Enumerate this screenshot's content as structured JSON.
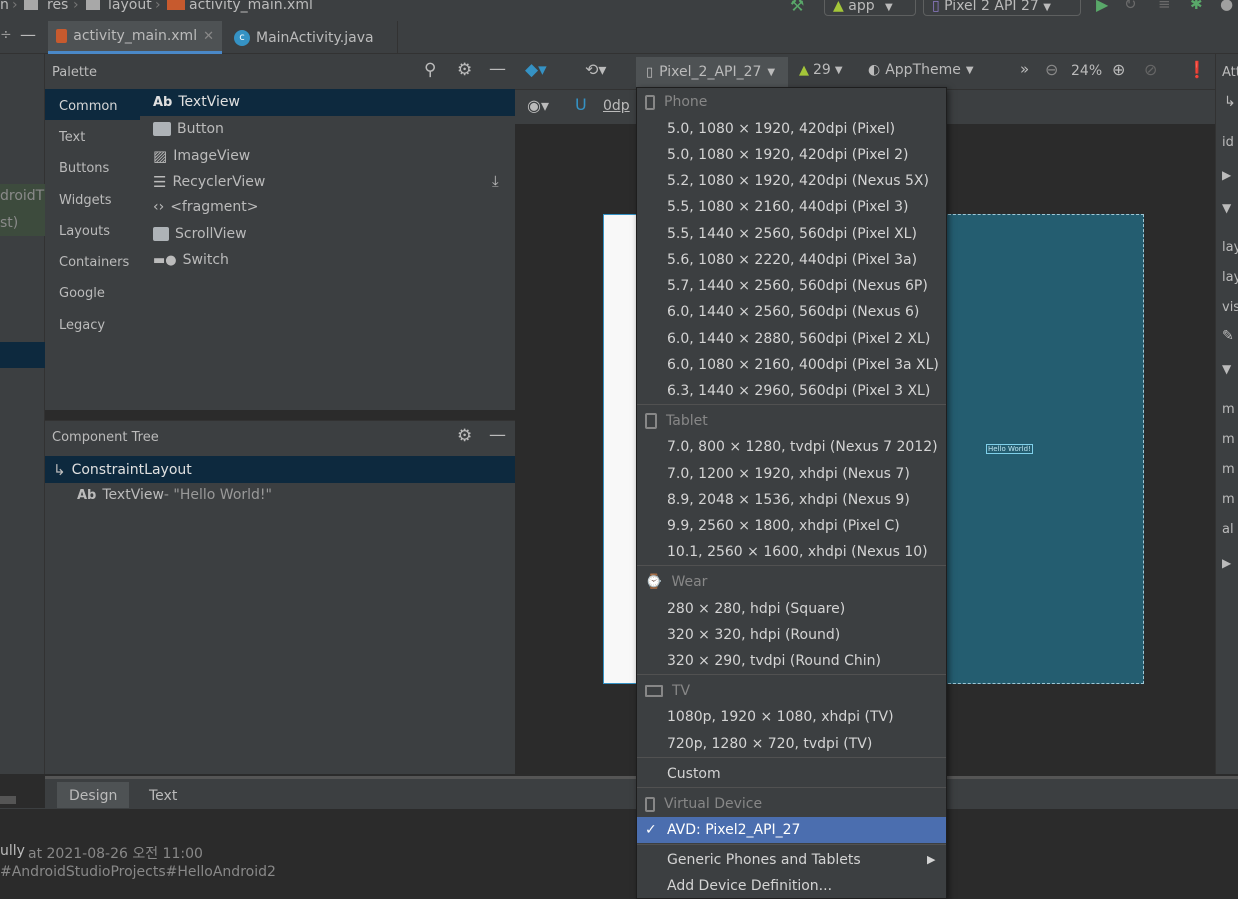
{
  "breadcrumb": {
    "first": "n",
    "res": "res",
    "layout": "layout",
    "file": "activity_main.xml"
  },
  "run_toolbar": {
    "module": "app",
    "device": "Pixel 2 API 27"
  },
  "editor_tabs": [
    {
      "label": "activity_main.xml",
      "active": true
    },
    {
      "label": "MainActivity.java",
      "active": false
    }
  ],
  "palette": {
    "title": "Palette",
    "categories": [
      "Common",
      "Text",
      "Buttons",
      "Widgets",
      "Layouts",
      "Containers",
      "Google",
      "Legacy"
    ],
    "items": [
      "TextView",
      "Button",
      "ImageView",
      "RecyclerView",
      "<fragment>",
      "ScrollView",
      "Switch"
    ],
    "textview_prefix": "Ab"
  },
  "component_tree": {
    "title": "Component Tree",
    "root": "ConstraintLayout",
    "child_prefix": "Ab",
    "child": "TextView",
    "child_text": "- \"Hello World!\""
  },
  "left_strip": {
    "line1": "droidT",
    "line2": "st)"
  },
  "design_toolbar": {
    "device": "Pixel_2_API_27",
    "api": "29",
    "theme": "AppTheme",
    "zoom": "24%",
    "margin": "0dp"
  },
  "canvas": {
    "hello_label": "Hello World!"
  },
  "right_panel": {
    "title": "Att",
    "labels": [
      "id",
      "lay",
      "lay",
      "vis",
      "m",
      "m",
      "m",
      "m",
      "al"
    ]
  },
  "bottom_tabs": [
    "Design",
    "Text"
  ],
  "status": {
    "user": "ully",
    "at": "at 2021-08-26 오전 11:00",
    "path": "#AndroidStudioProjects#HelloAndroid2"
  },
  "dropdown": {
    "phone_header": "Phone",
    "phones": [
      "5.0, 1080 × 1920, 420dpi (Pixel)",
      "5.0, 1080 × 1920, 420dpi (Pixel 2)",
      "5.2, 1080 × 1920, 420dpi (Nexus 5X)",
      "5.5, 1080 × 2160, 440dpi (Pixel 3)",
      "5.5, 1440 × 2560, 560dpi (Pixel XL)",
      "5.6, 1080 × 2220, 440dpi (Pixel 3a)",
      "5.7, 1440 × 2560, 560dpi (Nexus 6P)",
      "6.0, 1440 × 2560, 560dpi (Nexus 6)",
      "6.0, 1440 × 2880, 560dpi (Pixel 2 XL)",
      "6.0, 1080 × 2160, 400dpi (Pixel 3a XL)",
      "6.3, 1440 × 2960, 560dpi (Pixel 3 XL)"
    ],
    "tablet_header": "Tablet",
    "tablets": [
      "7.0, 800 × 1280, tvdpi (Nexus 7 2012)",
      "7.0, 1200 × 1920, xhdpi (Nexus 7)",
      "8.9, 2048 × 1536, xhdpi (Nexus 9)",
      "9.9, 2560 × 1800, xhdpi (Pixel C)",
      "10.1, 2560 × 1600, xhdpi (Nexus 10)"
    ],
    "wear_header": "Wear",
    "wears": [
      "280 × 280, hdpi (Square)",
      "320 × 320, hdpi (Round)",
      "320 × 290, tvdpi (Round Chin)"
    ],
    "tv_header": "TV",
    "tvs": [
      "1080p, 1920 × 1080, xhdpi (TV)",
      "720p, 1280 × 720, tvdpi (TV)"
    ],
    "custom": "Custom",
    "virtual_header": "Virtual Device",
    "avd": "AVD: Pixel2_API_27",
    "generic": "Generic Phones and Tablets",
    "add": "Add Device Definition..."
  },
  "colors": {
    "selected": "#4b6eaf",
    "blueprint": "#245d70",
    "accent": "#4a88c7"
  }
}
